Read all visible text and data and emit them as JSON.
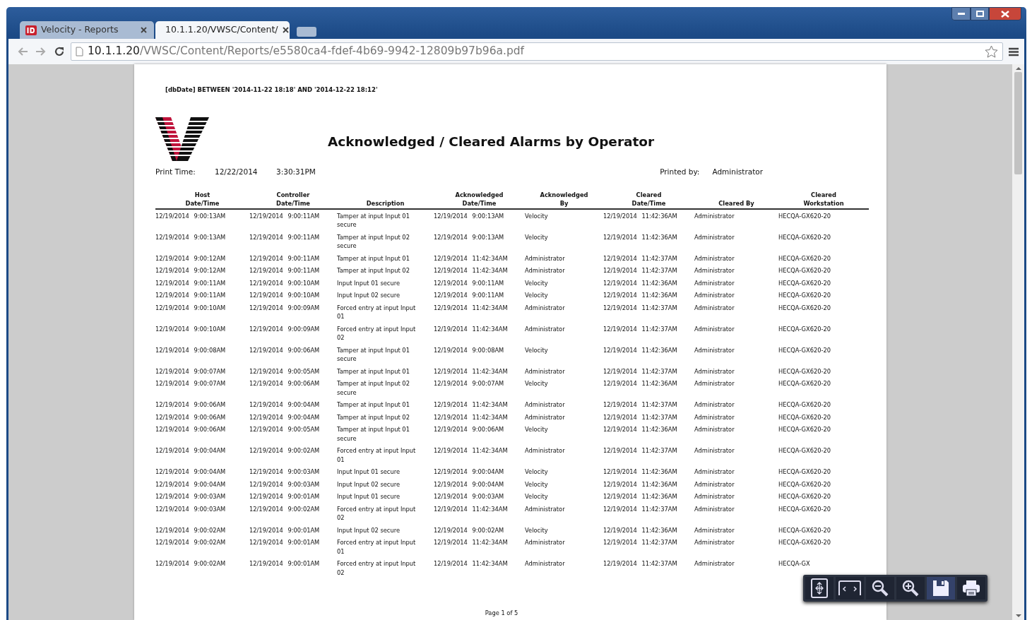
{
  "browser": {
    "tabs": [
      {
        "title": "Velocity - Reports",
        "selected": false,
        "kind": "app"
      },
      {
        "title": "10.1.1.20/VWSC/Content/",
        "selected": true,
        "kind": "page"
      }
    ],
    "address": {
      "host": "10.1.1.20",
      "path": "/VWSC/Content/Reports/e5580ca4-fdef-4b69-9942-12809b97b96a.pdf"
    }
  },
  "report": {
    "filter": "[dbDate] BETWEEN '2014-11-22 18:18' AND '2014-12-22 18:12'",
    "title": "Acknowledged / Cleared Alarms by Operator",
    "print_time_label": "Print Time:",
    "print_date": "12/22/2014",
    "print_time": "3:30:31PM",
    "printed_by_label": "Printed by:",
    "printed_by": "Administrator",
    "columns": [
      "Host\nDate/Time",
      "Controller\nDate/Time",
      "Description",
      "Acknowledged\nDate/Time",
      "Acknowledged\nBy",
      "Cleared\nDate/Time",
      "Cleared By",
      "Cleared\nWorkstation"
    ],
    "rows": [
      [
        "12/19/2014 9:00:13AM",
        "12/19/2014 9:00:11AM",
        "Tamper at input Input 01 secure",
        "12/19/2014 9:00:13AM",
        "Velocity",
        "12/19/2014 11:42:36AM",
        "Administrator",
        "HECQA-GX620-20"
      ],
      [
        "12/19/2014 9:00:13AM",
        "12/19/2014 9:00:11AM",
        "Tamper at input Input 02 secure",
        "12/19/2014 9:00:13AM",
        "Velocity",
        "12/19/2014 11:42:36AM",
        "Administrator",
        "HECQA-GX620-20"
      ],
      [
        "12/19/2014 9:00:12AM",
        "12/19/2014 9:00:11AM",
        "Tamper at input Input 01",
        "12/19/2014 11:42:34AM",
        "Administrator",
        "12/19/2014 11:42:37AM",
        "Administrator",
        "HECQA-GX620-20"
      ],
      [
        "12/19/2014 9:00:12AM",
        "12/19/2014 9:00:11AM",
        "Tamper at input Input 02",
        "12/19/2014 11:42:34AM",
        "Administrator",
        "12/19/2014 11:42:37AM",
        "Administrator",
        "HECQA-GX620-20"
      ],
      [
        "12/19/2014 9:00:11AM",
        "12/19/2014 9:00:10AM",
        "Input Input 01 secure",
        "12/19/2014 9:00:11AM",
        "Velocity",
        "12/19/2014 11:42:36AM",
        "Administrator",
        "HECQA-GX620-20"
      ],
      [
        "12/19/2014 9:00:11AM",
        "12/19/2014 9:00:10AM",
        "Input Input 02 secure",
        "12/19/2014 9:00:11AM",
        "Velocity",
        "12/19/2014 11:42:36AM",
        "Administrator",
        "HECQA-GX620-20"
      ],
      [
        "12/19/2014 9:00:10AM",
        "12/19/2014 9:00:09AM",
        "Forced entry at input Input 01",
        "12/19/2014 11:42:34AM",
        "Administrator",
        "12/19/2014 11:42:37AM",
        "Administrator",
        "HECQA-GX620-20"
      ],
      [
        "12/19/2014 9:00:10AM",
        "12/19/2014 9:00:09AM",
        "Forced entry at input Input 02",
        "12/19/2014 11:42:34AM",
        "Administrator",
        "12/19/2014 11:42:37AM",
        "Administrator",
        "HECQA-GX620-20"
      ],
      [
        "12/19/2014 9:00:08AM",
        "12/19/2014 9:00:06AM",
        "Tamper at input Input 01 secure",
        "12/19/2014 9:00:08AM",
        "Velocity",
        "12/19/2014 11:42:36AM",
        "Administrator",
        "HECQA-GX620-20"
      ],
      [
        "12/19/2014 9:00:07AM",
        "12/19/2014 9:00:05AM",
        "Tamper at input Input 01",
        "12/19/2014 11:42:34AM",
        "Administrator",
        "12/19/2014 11:42:37AM",
        "Administrator",
        "HECQA-GX620-20"
      ],
      [
        "12/19/2014 9:00:07AM",
        "12/19/2014 9:00:06AM",
        "Tamper at input Input 02 secure",
        "12/19/2014 9:00:07AM",
        "Velocity",
        "12/19/2014 11:42:36AM",
        "Administrator",
        "HECQA-GX620-20"
      ],
      [
        "12/19/2014 9:00:06AM",
        "12/19/2014 9:00:04AM",
        "Tamper at input Input 01",
        "12/19/2014 11:42:34AM",
        "Administrator",
        "12/19/2014 11:42:37AM",
        "Administrator",
        "HECQA-GX620-20"
      ],
      [
        "12/19/2014 9:00:06AM",
        "12/19/2014 9:00:04AM",
        "Tamper at input Input 02",
        "12/19/2014 11:42:34AM",
        "Administrator",
        "12/19/2014 11:42:37AM",
        "Administrator",
        "HECQA-GX620-20"
      ],
      [
        "12/19/2014 9:00:06AM",
        "12/19/2014 9:00:05AM",
        "Tamper at input Input 01 secure",
        "12/19/2014 9:00:06AM",
        "Velocity",
        "12/19/2014 11:42:36AM",
        "Administrator",
        "HECQA-GX620-20"
      ],
      [
        "12/19/2014 9:00:04AM",
        "12/19/2014 9:00:02AM",
        "Forced entry at input Input 01",
        "12/19/2014 11:42:34AM",
        "Administrator",
        "12/19/2014 11:42:37AM",
        "Administrator",
        "HECQA-GX620-20"
      ],
      [
        "12/19/2014 9:00:04AM",
        "12/19/2014 9:00:03AM",
        "Input Input 01 secure",
        "12/19/2014 9:00:04AM",
        "Velocity",
        "12/19/2014 11:42:36AM",
        "Administrator",
        "HECQA-GX620-20"
      ],
      [
        "12/19/2014 9:00:04AM",
        "12/19/2014 9:00:03AM",
        "Input Input 02 secure",
        "12/19/2014 9:00:04AM",
        "Velocity",
        "12/19/2014 11:42:36AM",
        "Administrator",
        "HECQA-GX620-20"
      ],
      [
        "12/19/2014 9:00:03AM",
        "12/19/2014 9:00:01AM",
        "Input Input 01 secure",
        "12/19/2014 9:00:03AM",
        "Velocity",
        "12/19/2014 11:42:36AM",
        "Administrator",
        "HECQA-GX620-20"
      ],
      [
        "12/19/2014 9:00:03AM",
        "12/19/2014 9:00:02AM",
        "Forced entry at input Input 02",
        "12/19/2014 11:42:34AM",
        "Administrator",
        "12/19/2014 11:42:37AM",
        "Administrator",
        "HECQA-GX620-20"
      ],
      [
        "12/19/2014 9:00:02AM",
        "12/19/2014 9:00:01AM",
        "Input Input 02 secure",
        "12/19/2014 9:00:02AM",
        "Velocity",
        "12/19/2014 11:42:36AM",
        "Administrator",
        "HECQA-GX620-20"
      ],
      [
        "12/19/2014 9:00:02AM",
        "12/19/2014 9:00:01AM",
        "Forced entry at input Input 01",
        "12/19/2014 11:42:34AM",
        "Administrator",
        "12/19/2014 11:42:37AM",
        "Administrator",
        "HECQA-GX620-20"
      ],
      [
        "12/19/2014 9:00:02AM",
        "12/19/2014 9:00:01AM",
        "Forced entry at input Input 02",
        "12/19/2014 11:42:34AM",
        "Administrator",
        "12/19/2014 11:42:37AM",
        "Administrator",
        "HECQA-GX"
      ]
    ],
    "footer": "Page 1 of 5"
  }
}
